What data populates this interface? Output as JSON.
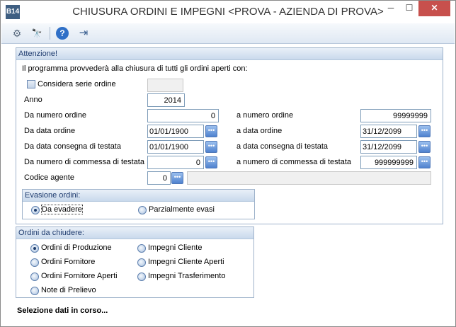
{
  "window": {
    "icon_text": "B14",
    "title": "CHIUSURA ORDINI E IMPEGNI <PROVA - AZIENDA DI PROVA>",
    "min": "─",
    "max": "☐",
    "close": "✕"
  },
  "toolbar": {
    "settings_icon": "⚙",
    "search_icon": "🔭",
    "help_icon": "?",
    "exit_icon": "⇥"
  },
  "attenzione": {
    "header": "Attenzione!",
    "info": "Il programma provvederà alla chiusura di tutti gli ordini aperti con:",
    "considera_label": "Considera serie ordine",
    "considera_value": "",
    "anno_label": "Anno",
    "anno_value": "2014",
    "da_numero_label": "Da numero ordine",
    "da_numero_value": "0",
    "a_numero_label": "a numero ordine",
    "a_numero_value": "99999999",
    "da_data_label": "Da data ordine",
    "da_data_value": "01/01/1900",
    "a_data_label": "a data ordine",
    "a_data_value": "31/12/2099",
    "da_consegna_label": "Da data consegna di testata",
    "da_consegna_value": "01/01/1900",
    "a_consegna_label": "a data consegna di testata",
    "a_consegna_value": "31/12/2099",
    "da_commessa_label": "Da numero di commessa di testata",
    "da_commessa_value": "0",
    "a_commessa_label": "a numero di commessa di testata",
    "a_commessa_value": "999999999",
    "agente_label": "Codice agente",
    "agente_value": "0",
    "agente_desc": "",
    "dots": "•••"
  },
  "evasione": {
    "header": "Evasione ordini:",
    "opt1": "Da evadere",
    "opt2": "Parzialmente evasi",
    "selected": "Da evadere"
  },
  "ordini": {
    "header": "Ordini da chiudere:",
    "opt_produzione": "Ordini di Produzione",
    "opt_fornitore": "Ordini Fornitore",
    "opt_fornitore_aperti": "Ordini Fornitore Aperti",
    "opt_prelievo": "Note di Prelievo",
    "opt_impegni_cliente": "Impegni Cliente",
    "opt_impegni_cliente_aperti": "Impegni Cliente Aperti",
    "opt_impegni_trasf": "Impegni Trasferimento",
    "selected": "Ordini di Produzione"
  },
  "status": "Selezione dati in corso..."
}
